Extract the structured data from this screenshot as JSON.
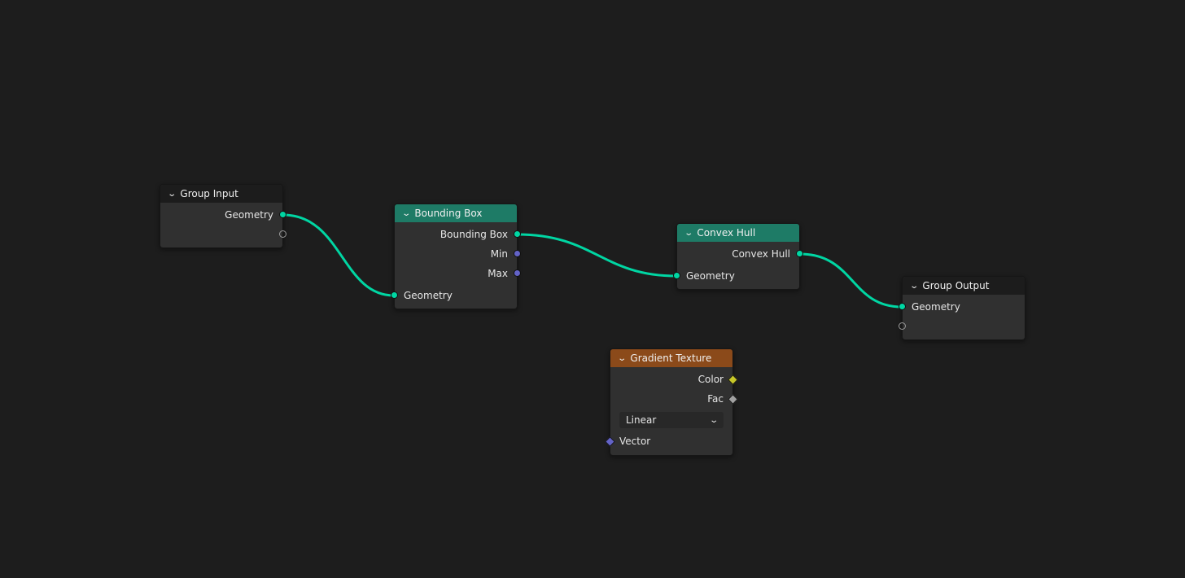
{
  "nodes": {
    "group_input": {
      "title": "Group Input",
      "outputs": [
        "Geometry"
      ]
    },
    "bounding_box": {
      "title": "Bounding Box",
      "outputs": [
        "Bounding Box",
        "Min",
        "Max"
      ],
      "inputs": [
        "Geometry"
      ]
    },
    "convex_hull": {
      "title": "Convex Hull",
      "outputs": [
        "Convex Hull"
      ],
      "inputs": [
        "Geometry"
      ]
    },
    "group_output": {
      "title": "Group Output",
      "inputs": [
        "Geometry"
      ]
    },
    "gradient_texture": {
      "title": "Gradient Texture",
      "outputs": [
        "Color",
        "Fac"
      ],
      "dropdown": "Linear",
      "inputs": [
        "Vector"
      ]
    }
  },
  "colors": {
    "background": "#1d1d1d",
    "link": "#00d6a3",
    "geometry_socket": "#00d6a3",
    "vector_socket": "#6363c7",
    "color_socket": "#c7c729",
    "float_socket": "#a1a1a1",
    "geometry_header": "#1e7b66",
    "texture_header": "#8b4a1a"
  },
  "icons": {
    "collapse": "chevron-down-icon",
    "dropdown": "chevron-down-icon"
  }
}
